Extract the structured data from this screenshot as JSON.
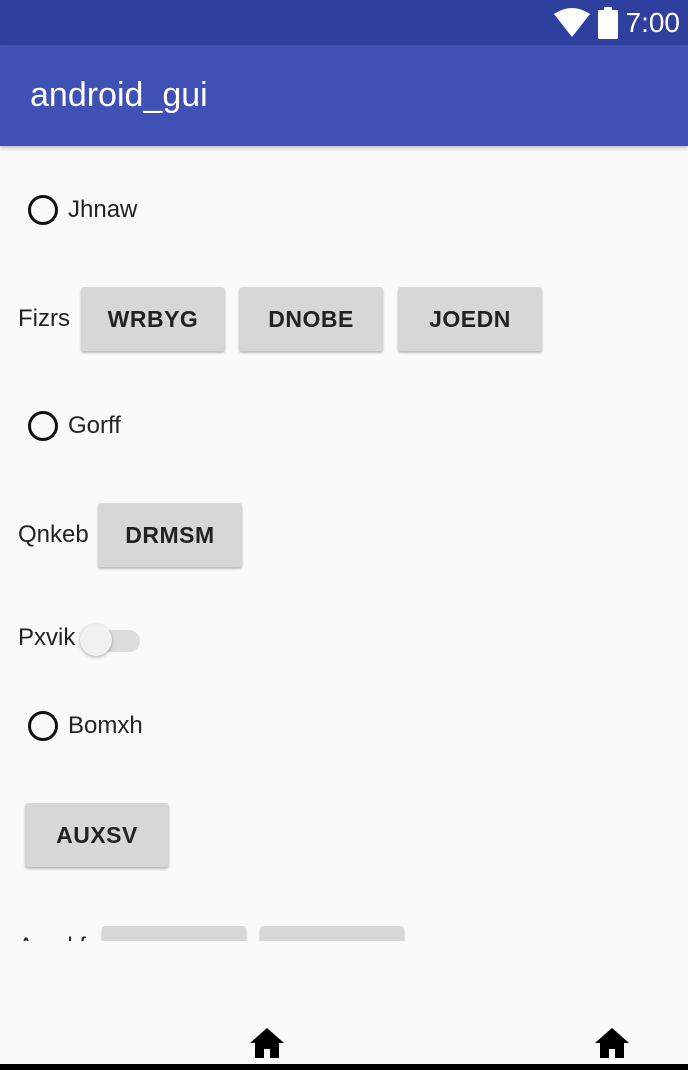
{
  "status_bar": {
    "time": "7:00",
    "icons": [
      "wifi-icon",
      "battery-icon"
    ],
    "background": "#2f3f9e"
  },
  "app_bar": {
    "title": "android_gui",
    "background": "#3f51b5"
  },
  "content": {
    "radio_1": {
      "label": "Jhnaw",
      "checked": false
    },
    "row_fizrs": {
      "label": "Fizrs",
      "buttons": [
        "WRBYG",
        "DNOBE",
        "JOEDN"
      ]
    },
    "radio_2": {
      "label": "Gorff",
      "checked": false
    },
    "row_qnkeb": {
      "label": "Qnkeb",
      "buttons": [
        "DRMSM"
      ]
    },
    "row_pxvik": {
      "label": "Pxvik",
      "switch_on": false
    },
    "radio_3": {
      "label": "Bomxh",
      "checked": false
    },
    "standalone_button": "AUXSV",
    "row_partial": {
      "label": "Amgkf"
    }
  },
  "nav_bar": {
    "icons": [
      "home-icon",
      "home-icon"
    ]
  }
}
